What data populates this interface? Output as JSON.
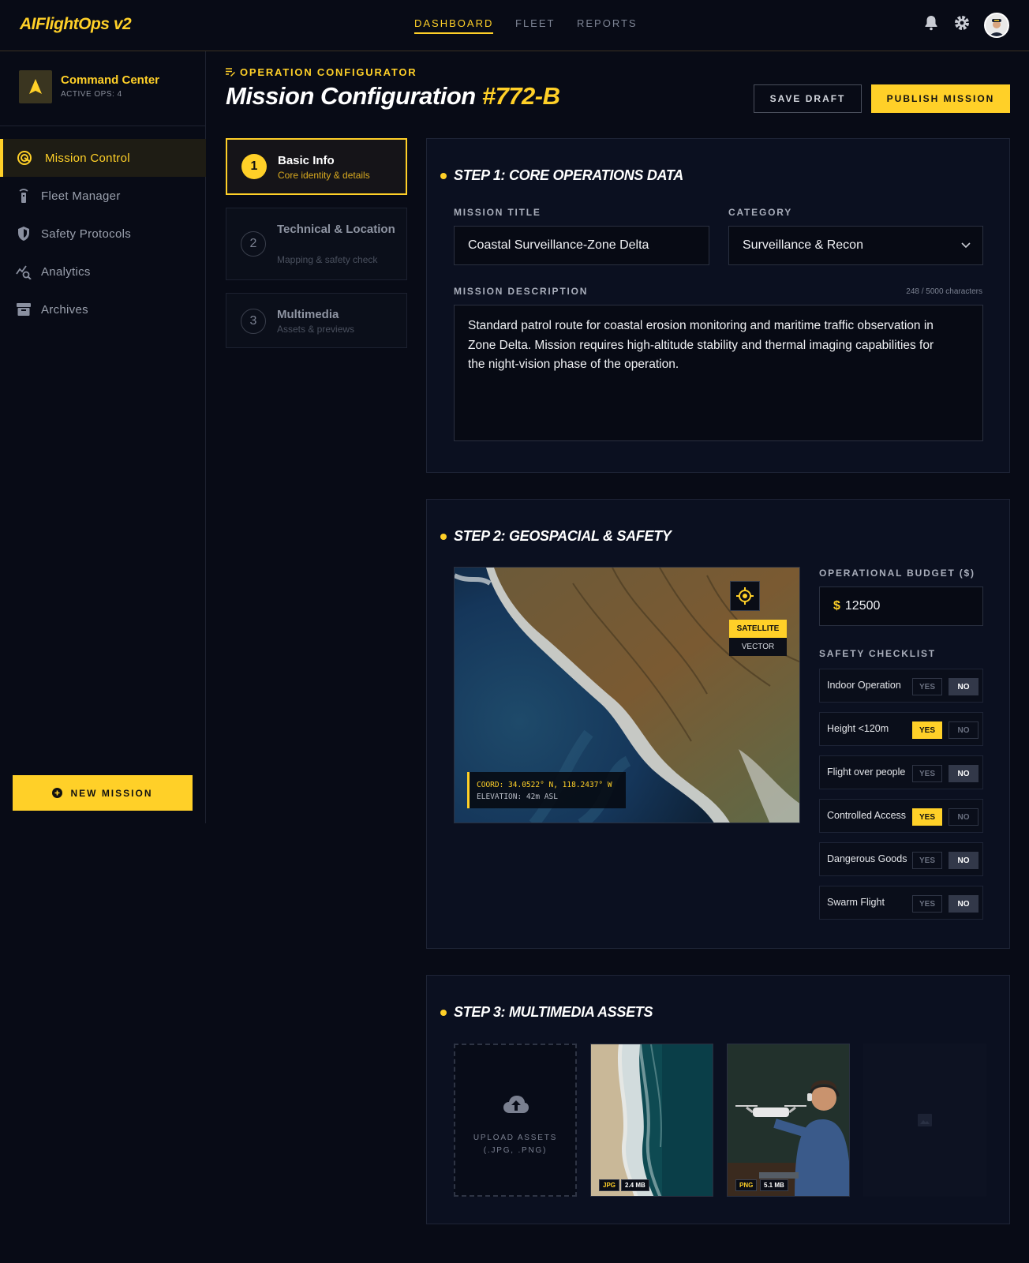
{
  "app": {
    "logo": "AIFlightOps v2"
  },
  "topnav": {
    "dashboard": "DASHBOARD",
    "fleet": "FLEET",
    "reports": "REPORTS"
  },
  "sidebar": {
    "title": "Command Center",
    "subtitle": "ACTIVE OPS: 4",
    "items": [
      {
        "label": "Mission Control",
        "icon": "target-icon"
      },
      {
        "label": "Fleet Manager",
        "icon": "tower-icon"
      },
      {
        "label": "Safety Protocols",
        "icon": "shield-icon"
      },
      {
        "label": "Analytics",
        "icon": "analytics-icon"
      },
      {
        "label": "Archives",
        "icon": "archive-icon"
      }
    ],
    "new_mission": "NEW MISSION"
  },
  "header": {
    "eyebrow": "OPERATION CONFIGURATOR",
    "title": "Mission Configuration",
    "id": "#772-B",
    "save_draft": "SAVE DRAFT",
    "publish": "PUBLISH MISSION"
  },
  "steps": [
    {
      "num": "1",
      "title": "Basic Info",
      "sub": "Core identity & details"
    },
    {
      "num": "2",
      "title": "Technical & Location",
      "sub": "Mapping & safety check"
    },
    {
      "num": "3",
      "title": "Multimedia",
      "sub": "Assets & previews"
    }
  ],
  "step1": {
    "heading": "STEP 1: CORE OPERATIONS DATA",
    "title_label": "MISSION TITLE",
    "title_value": "Coastal Surveillance-Zone Delta",
    "category_label": "CATEGORY",
    "category_value": "Surveillance & Recon",
    "desc_label": "MISSION DESCRIPTION",
    "desc_counter": "248 / 5000 characters",
    "desc_value": "Standard patrol route for coastal erosion monitoring and maritime traffic observation in Zone Delta. Mission requires high-altitude stability and thermal imaging capabilities for the night-vision phase of the operation."
  },
  "step2": {
    "heading": "STEP 2: GEOSPACIAL & SAFETY",
    "coord": "COORD: 34.0522° N, 118.2437° W",
    "elevation": "ELEVATION: 42m ASL",
    "satellite": "SATELLITE",
    "vector": "VECTOR",
    "budget_label": "OPERATIONAL BUDGET ($)",
    "budget_currency": "$",
    "budget_value": "12500",
    "checklist_label": "SAFETY CHECKLIST",
    "yes": "YES",
    "no": "NO",
    "checklist": [
      {
        "label": "Indoor Operation",
        "value": "NO"
      },
      {
        "label": "Height <120m",
        "value": "YES"
      },
      {
        "label": "Flight over people",
        "value": "NO"
      },
      {
        "label": "Controlled Access",
        "value": "YES"
      },
      {
        "label": "Dangerous Goods",
        "value": "NO"
      },
      {
        "label": "Swarm Flight",
        "value": "NO"
      }
    ]
  },
  "step3": {
    "heading": "STEP 3: MULTIMEDIA ASSETS",
    "upload_line1": "UPLOAD ASSETS",
    "upload_line2": "(.JPG, .PNG)",
    "assets": [
      {
        "type": "JPG",
        "size": "2.4 MB"
      },
      {
        "type": "PNG",
        "size": "5.1 MB"
      }
    ]
  },
  "colors": {
    "accent": "#ffd028",
    "background": "#080b16",
    "panel": "#0b1020"
  }
}
